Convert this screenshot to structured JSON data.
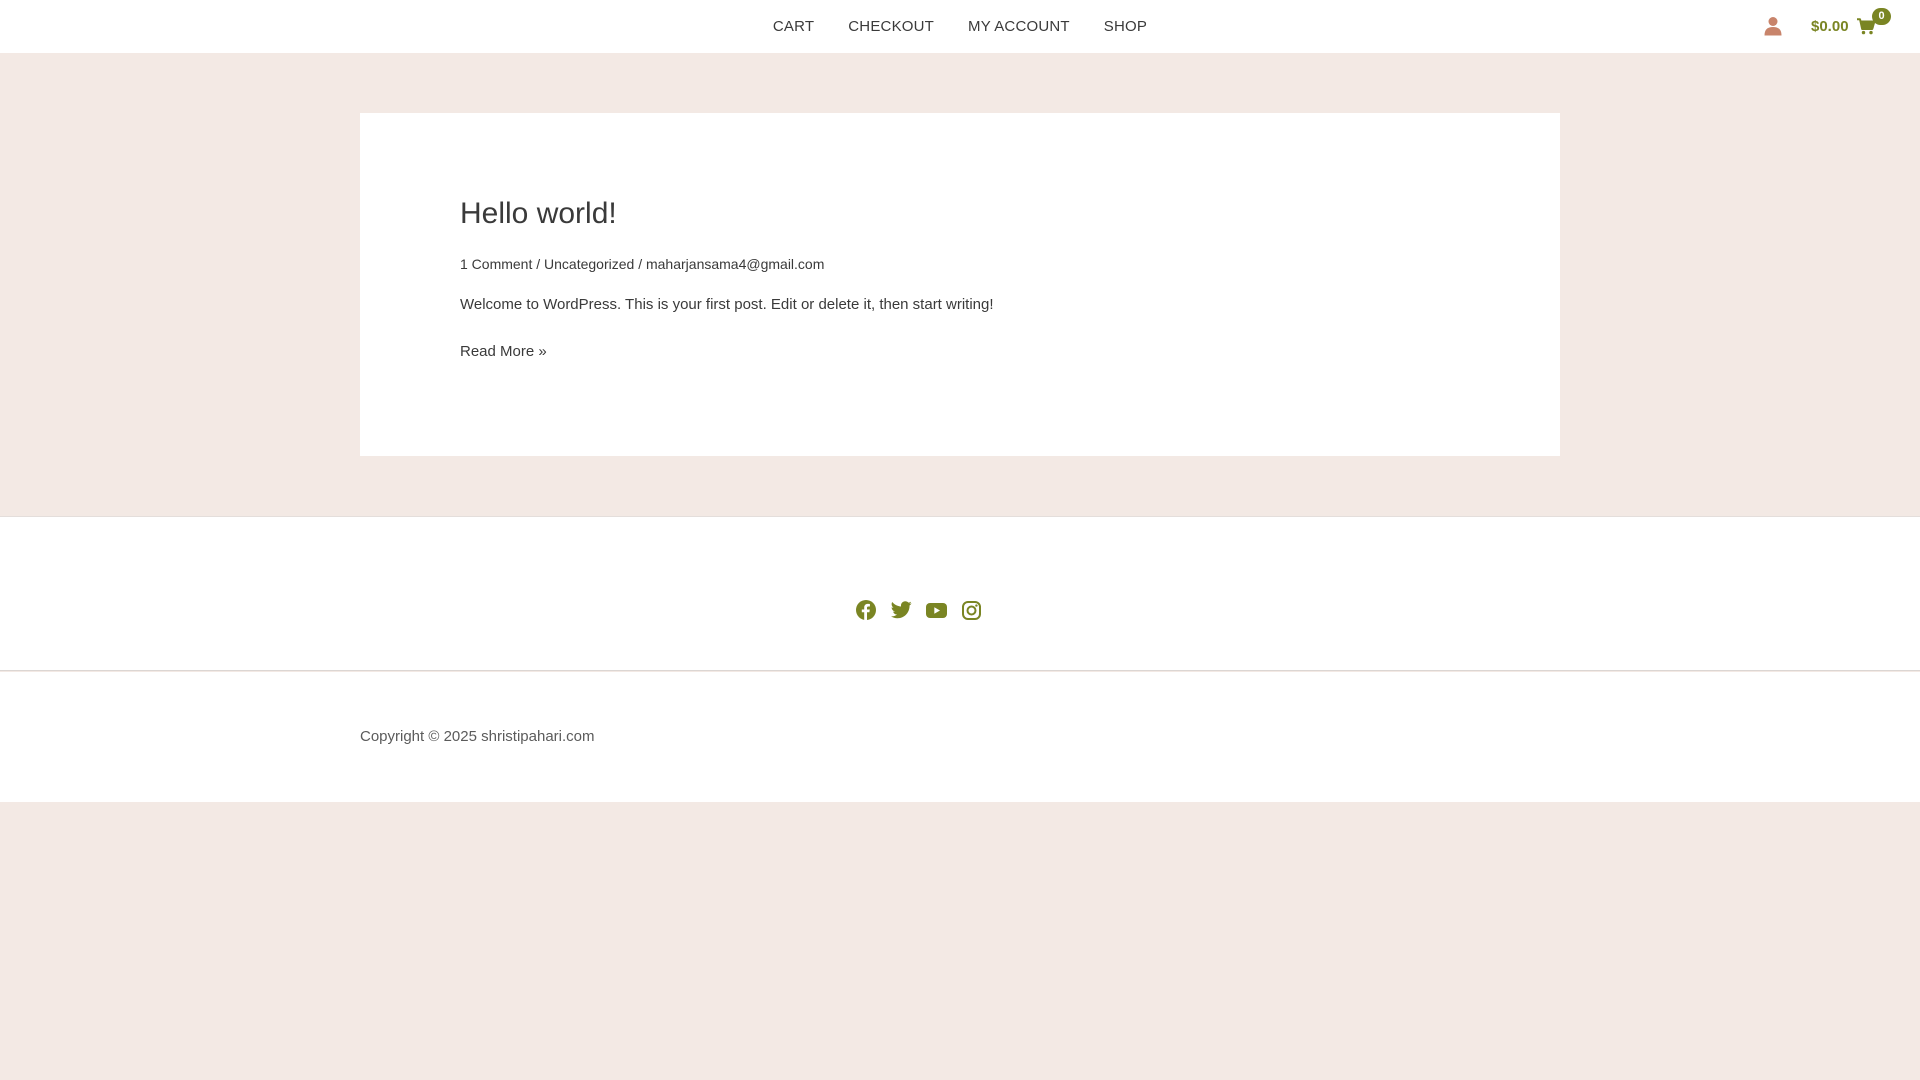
{
  "nav": {
    "items": [
      {
        "label": "CART"
      },
      {
        "label": "CHECKOUT"
      },
      {
        "label": "MY ACCOUNT"
      },
      {
        "label": "SHOP"
      }
    ]
  },
  "header": {
    "account_icon": "user-icon",
    "cart_total": "$0.00",
    "cart_icon": "shopping-cart-icon",
    "cart_count": "0",
    "accent_color": "#7a8523",
    "account_icon_color": "#c8846b"
  },
  "post": {
    "title": "Hello world!",
    "meta": {
      "comments": "1 Comment",
      "separator": " / ",
      "category": "Uncategorized",
      "author": "maharjansama4@gmail.com"
    },
    "excerpt": "Welcome to WordPress. This is your first post. Edit or delete it, then start writing!",
    "read_more": "Read More »"
  },
  "footer": {
    "social": [
      {
        "icon": "facebook-icon"
      },
      {
        "icon": "twitter-icon"
      },
      {
        "icon": "youtube-icon"
      },
      {
        "icon": "instagram-icon"
      }
    ],
    "copyright": "Copyright © 2025 shristipahari.com"
  },
  "colors": {
    "page_background": "#f3e9e4",
    "card_background": "#ffffff",
    "text": "#3a3a3a",
    "accent": "#7a8523"
  }
}
